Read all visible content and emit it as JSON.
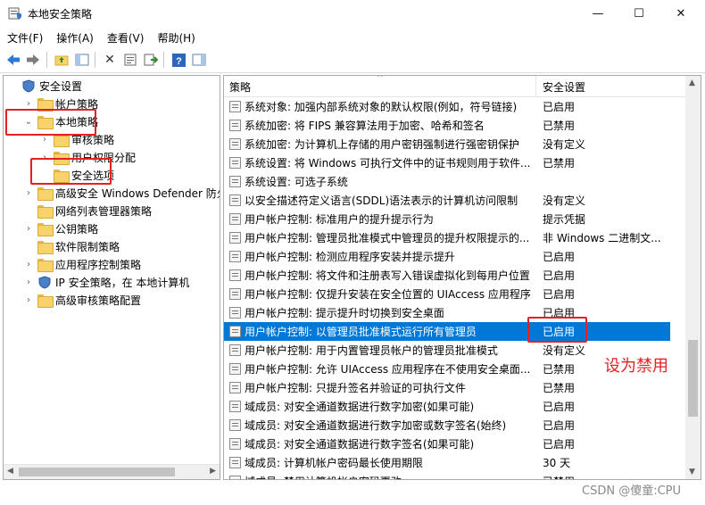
{
  "window": {
    "title": "本地安全策略",
    "controls": {
      "minimize": "—",
      "maximize": "☐",
      "close": "✕"
    }
  },
  "menu": [
    "文件(F)",
    "操作(A)",
    "查看(V)",
    "帮助(H)"
  ],
  "toolbar": {
    "icons": [
      "back-arrow-icon",
      "forward-arrow-icon",
      "up-folder-icon",
      "show-hide-tree-icon",
      "delete-icon",
      "properties-icon",
      "export-list-icon",
      "help-icon",
      "action-pane-icon"
    ]
  },
  "tree": [
    {
      "label": "安全设置",
      "level": 0,
      "expander": "",
      "icon": "shield"
    },
    {
      "label": "帐户策略",
      "level": 1,
      "expander": "›",
      "icon": "folder"
    },
    {
      "label": "本地策略",
      "level": 1,
      "expander": "⌄",
      "icon": "folder"
    },
    {
      "label": "审核策略",
      "level": 2,
      "expander": "›",
      "icon": "folder"
    },
    {
      "label": "用户权限分配",
      "level": 2,
      "expander": "›",
      "icon": "folder"
    },
    {
      "label": "安全选项",
      "level": 2,
      "expander": "",
      "icon": "folder"
    },
    {
      "label": "高级安全 Windows Defender 防火墙",
      "level": 1,
      "expander": "›",
      "icon": "folder"
    },
    {
      "label": "网络列表管理器策略",
      "level": 1,
      "expander": "",
      "icon": "folder"
    },
    {
      "label": "公钥策略",
      "level": 1,
      "expander": "›",
      "icon": "folder"
    },
    {
      "label": "软件限制策略",
      "level": 1,
      "expander": "",
      "icon": "folder"
    },
    {
      "label": "应用程序控制策略",
      "level": 1,
      "expander": "›",
      "icon": "folder"
    },
    {
      "label": "IP 安全策略，在 本地计算机",
      "level": 1,
      "expander": "›",
      "icon": "shield"
    },
    {
      "label": "高级审核策略配置",
      "level": 1,
      "expander": "›",
      "icon": "folder"
    }
  ],
  "columns": {
    "policy": "策略",
    "setting": "安全设置",
    "sort_indicator": "^"
  },
  "policies": [
    {
      "name": "系统对象: 加强内部系统对象的默认权限(例如，符号链接)",
      "value": "已启用"
    },
    {
      "name": "系统加密: 将 FIPS 兼容算法用于加密、哈希和签名",
      "value": "已禁用"
    },
    {
      "name": "系统加密: 为计算机上存储的用户密钥强制进行强密钥保护",
      "value": "没有定义"
    },
    {
      "name": "系统设置: 将 Windows 可执行文件中的证书规则用于软件...",
      "value": "已禁用"
    },
    {
      "name": "系统设置: 可选子系统",
      "value": ""
    },
    {
      "name": "以安全描述符定义语言(SDDL)语法表示的计算机访问限制",
      "value": "没有定义"
    },
    {
      "name": "用户帐户控制: 标准用户的提升提示行为",
      "value": "提示凭据"
    },
    {
      "name": "用户帐户控制: 管理员批准模式中管理员的提升权限提示的...",
      "value": "非 Windows 二进制文..."
    },
    {
      "name": "用户帐户控制: 检测应用程序安装并提示提升",
      "value": "已启用"
    },
    {
      "name": "用户帐户控制: 将文件和注册表写入错误虚拟化到每用户位置",
      "value": "已启用"
    },
    {
      "name": "用户帐户控制: 仅提升安装在安全位置的 UIAccess 应用程序",
      "value": "已启用"
    },
    {
      "name": "用户帐户控制: 提示提升时切换到安全桌面",
      "value": "已启用"
    },
    {
      "name": "用户帐户控制: 以管理员批准模式运行所有管理员",
      "value": "已启用",
      "selected": true
    },
    {
      "name": "用户帐户控制: 用于内置管理员帐户的管理员批准模式",
      "value": "没有定义"
    },
    {
      "name": "用户帐户控制: 允许 UIAccess 应用程序在不使用安全桌面...",
      "value": "已禁用"
    },
    {
      "name": "用户帐户控制: 只提升签名并验证的可执行文件",
      "value": "已禁用"
    },
    {
      "name": "域成员: 对安全通道数据进行数字加密(如果可能)",
      "value": "已启用"
    },
    {
      "name": "域成员: 对安全通道数据进行数字加密或数字签名(始终)",
      "value": "已启用"
    },
    {
      "name": "域成员: 对安全通道数据进行数字签名(如果可能)",
      "value": "已启用"
    },
    {
      "name": "域成员: 计算机帐户密码最长使用期限",
      "value": "30 天"
    },
    {
      "name": "域成员: 禁用计算机帐户密码更改",
      "value": "已禁用"
    }
  ],
  "annotation": {
    "text": "设为禁用",
    "color": "#e52020"
  },
  "watermark": "CSDN @傻童:CPU",
  "colors": {
    "selection": "#0078d7",
    "annotation": "#e52020",
    "folder": "#f7d46b"
  }
}
